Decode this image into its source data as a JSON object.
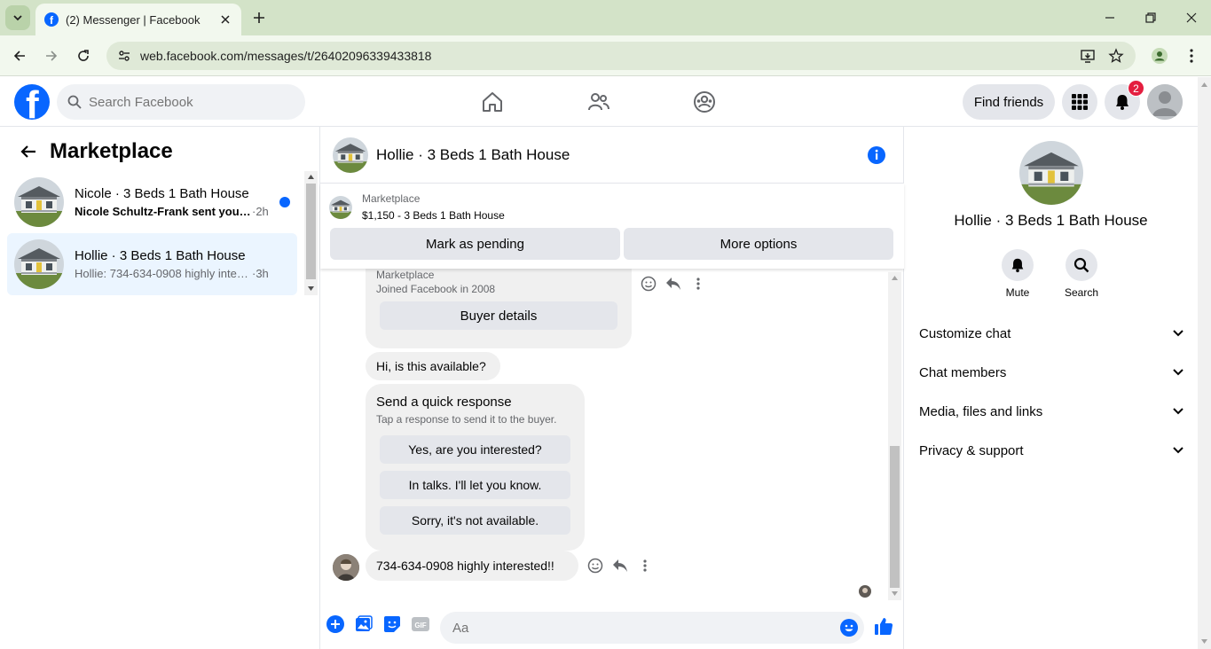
{
  "browser": {
    "tab_title": "(2) Messenger | Facebook",
    "url": "web.facebook.com/messages/t/26402096339433818"
  },
  "fb": {
    "search_placeholder": "Search Facebook",
    "find_friends": "Find friends",
    "notif_count": "2",
    "brand_color": "#0866ff"
  },
  "left": {
    "title": "Marketplace",
    "conversations": [
      {
        "title": "Nicole · 3 Beds 1 Bath House",
        "preview": "Nicole Schultz-Frank sent you a...",
        "time": "·2h",
        "unread": true
      },
      {
        "title": "Hollie · 3 Beds 1 Bath House",
        "preview": "Hollie: 734-634-0908 highly intere...",
        "time": "·3h",
        "unread": false
      }
    ]
  },
  "chat": {
    "title": "Hollie · 3 Beds 1 Bath House",
    "banner": {
      "label": "Marketplace",
      "price": "$1,150 - 3 Beds 1 Bath House",
      "mark_pending": "Mark as pending",
      "more_options": "More options"
    },
    "messages": {
      "profile_card": {
        "line1": "Marketplace",
        "line2": "Joined Facebook in 2008",
        "button": "Buyer details"
      },
      "question": "Hi, is this available?",
      "quick": {
        "title": "Send a quick response",
        "subtitle": "Tap a response to send it to the buyer.",
        "options": [
          "Yes, are you interested?",
          "In talks. I'll let you know.",
          "Sorry, it's not available."
        ]
      },
      "reply": "734-634-0908 highly interested!!"
    },
    "composer_placeholder": "Aa"
  },
  "right": {
    "name": "Hollie · 3 Beds 1 Bath House",
    "actions": [
      "Mute",
      "Search"
    ],
    "sections": [
      "Customize chat",
      "Chat members",
      "Media, files and links",
      "Privacy & support"
    ]
  }
}
